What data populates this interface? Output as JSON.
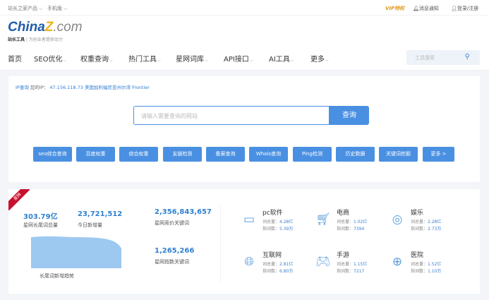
{
  "topbar": {
    "products": "站长之家产品",
    "mobile": "手机版",
    "vip": "VIP特权",
    "notice": "消息通知",
    "login": "登录/注册"
  },
  "logo": {
    "text_main": "China",
    "text_z": "Z",
    "text_tld": ".com",
    "brand": "站长工具",
    "slogan": "为创业者提供动力"
  },
  "nav": {
    "items": [
      "首页",
      "SEO优化",
      "权重查询",
      "热门工具",
      "星网词库",
      "API接口",
      "AI工具",
      "更多"
    ],
    "search_placeholder": "工具搜索"
  },
  "ip": {
    "label": "IP查询",
    "your_ip": "您的IP：",
    "value": "47.156.118.73 美国加利福尼亚州尔湾 Frontier"
  },
  "query": {
    "placeholder": "请输入需要查询的网站",
    "button": "查询"
  },
  "quick_links": [
    "seo综合查询",
    "百度权重",
    "综合权重",
    "友链检测",
    "备案查询",
    "Whois查询",
    "Ping检测",
    "历史数据",
    "关键词挖掘",
    "更多 >"
  ],
  "stats": {
    "ribbon": "星网",
    "total": {
      "value": "303.79亿",
      "label": "星网长尾词总量"
    },
    "today": {
      "value": "23,721,512",
      "label": "今日新增量"
    },
    "bid": {
      "value": "2,356,843,657",
      "label": "星网竞价关键词"
    },
    "index": {
      "value": "1,265,266",
      "label": "星网指数关键词"
    },
    "trend_label": "长尾词新增趋势",
    "trend_color": "#9dc8f0"
  },
  "cat_labels": {
    "total": "词总量：",
    "index": "指词数："
  },
  "categories": [
    {
      "name": "pc软件",
      "total": "4.28亿",
      "index": "5.39万",
      "icon": "monitor-code-icon"
    },
    {
      "name": "电商",
      "total": "1.02亿",
      "index": "7394",
      "icon": "cart-icon"
    },
    {
      "name": "娱乐",
      "total": "2.28亿",
      "index": "2.73万",
      "icon": "entertainment-icon"
    },
    {
      "name": "互联网",
      "total": "2.81亿",
      "index": "6.80万",
      "icon": "globe-icon"
    },
    {
      "name": "手游",
      "total": "1.15亿",
      "index": "7217",
      "icon": "gamepad-icon"
    },
    {
      "name": "医院",
      "total": "1.52亿",
      "index": "1.10万",
      "icon": "medical-kit-icon"
    }
  ]
}
